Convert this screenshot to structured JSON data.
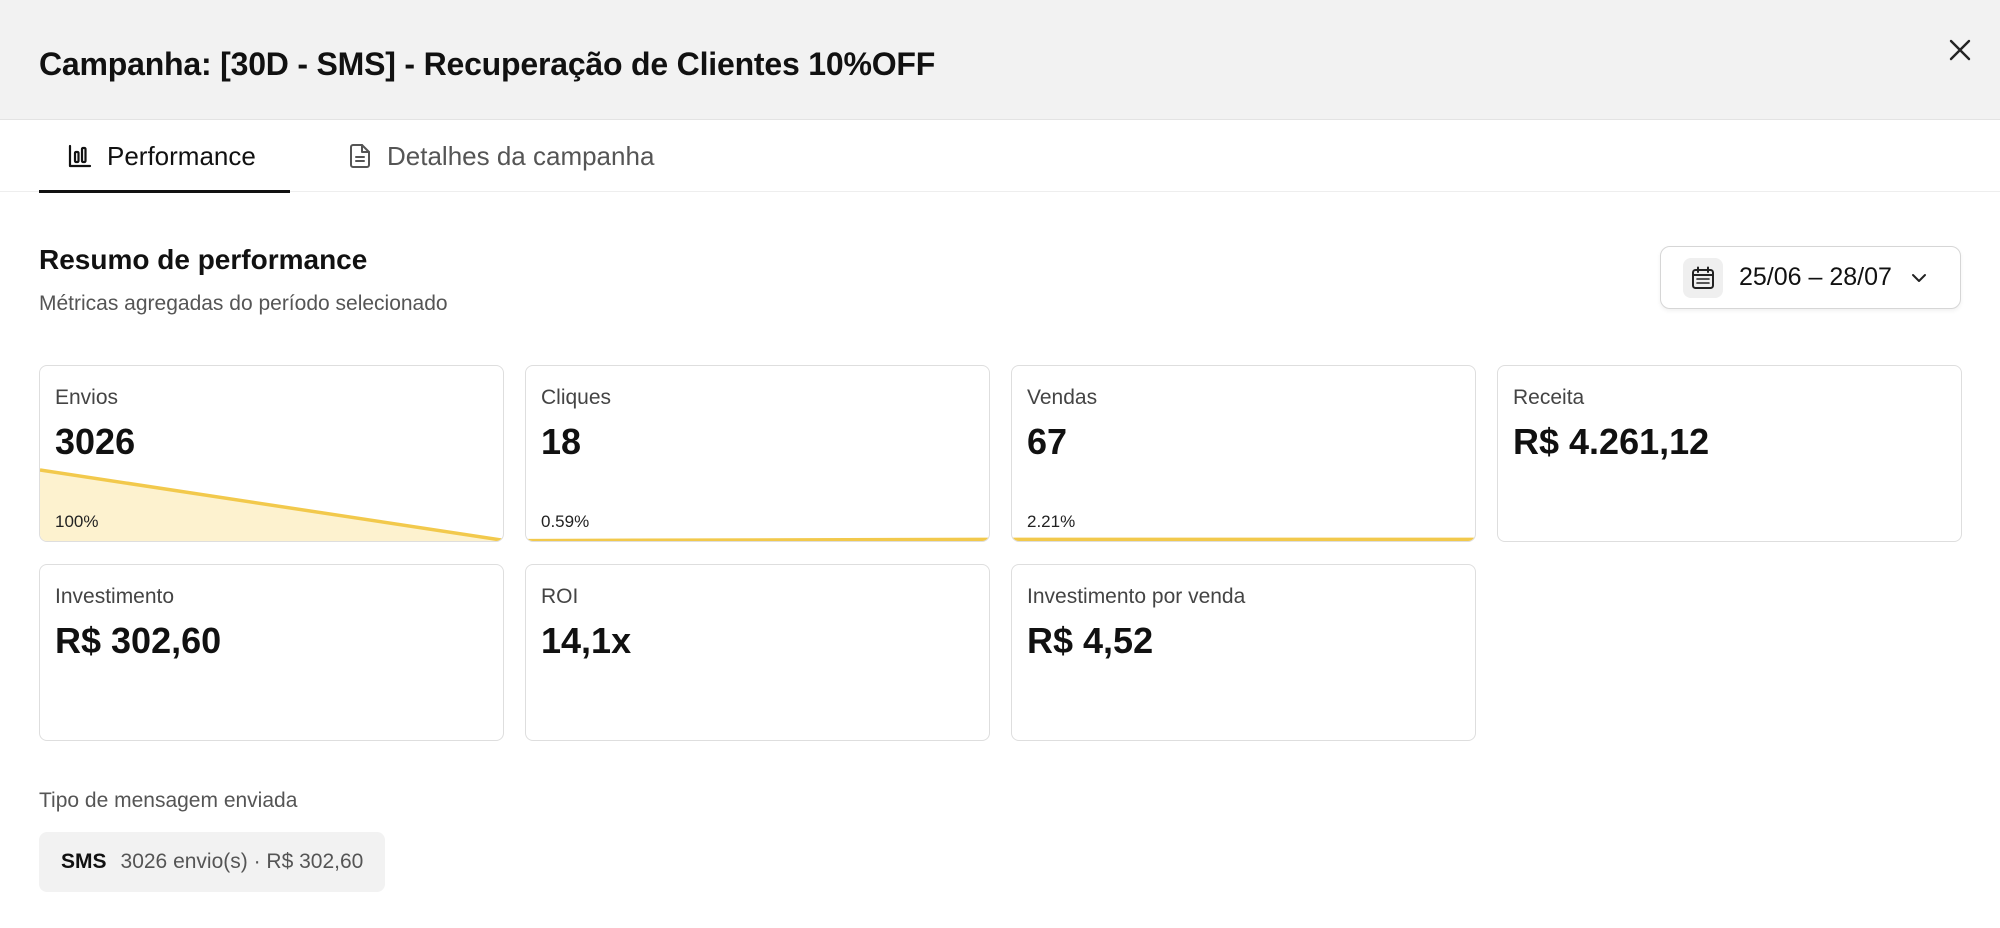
{
  "modal": {
    "title": "Campanha: [30D - SMS] - Recuperação de Clientes 10%OFF",
    "close_icon": "close-icon"
  },
  "tabs": [
    {
      "label": "Performance",
      "icon": "bar-chart-icon",
      "active": true
    },
    {
      "label": "Detalhes da campanha",
      "icon": "document-icon",
      "active": false
    }
  ],
  "summary": {
    "title": "Resumo de performance",
    "subtitle": "Métricas agregadas do período selecionado"
  },
  "date_range": {
    "label": "25/06 – 28/07",
    "icon": "calendar-icon",
    "chevron": "chevron-down-icon"
  },
  "metrics": {
    "envios": {
      "label": "Envios",
      "value": "3026",
      "pct_label": "100%",
      "funnel_from": 1.0,
      "funnel_to": 0.0059
    },
    "cliques": {
      "label": "Cliques",
      "value": "18",
      "pct_label": "0.59%",
      "funnel_from": 0.0059,
      "funnel_to": 0.0221
    },
    "vendas": {
      "label": "Vendas",
      "value": "67",
      "pct_label": "2.21%",
      "funnel_from": 0.0221,
      "funnel_to": 0.0221
    },
    "receita": {
      "label": "Receita",
      "value": "R$ 4.261,12"
    },
    "investimento": {
      "label": "Investimento",
      "value": "R$ 302,60"
    },
    "roi": {
      "label": "ROI",
      "value": "14,1x"
    },
    "investimento_por_venda": {
      "label": "Investimento por venda",
      "value": "R$ 4,52"
    }
  },
  "message_types": {
    "title": "Tipo de mensagem enviada",
    "items": [
      {
        "type": "SMS",
        "info": "3026 envio(s) · R$ 302,60"
      }
    ]
  },
  "colors": {
    "accent": "#f2c94c",
    "accent_fill": "#fdf2cf"
  }
}
